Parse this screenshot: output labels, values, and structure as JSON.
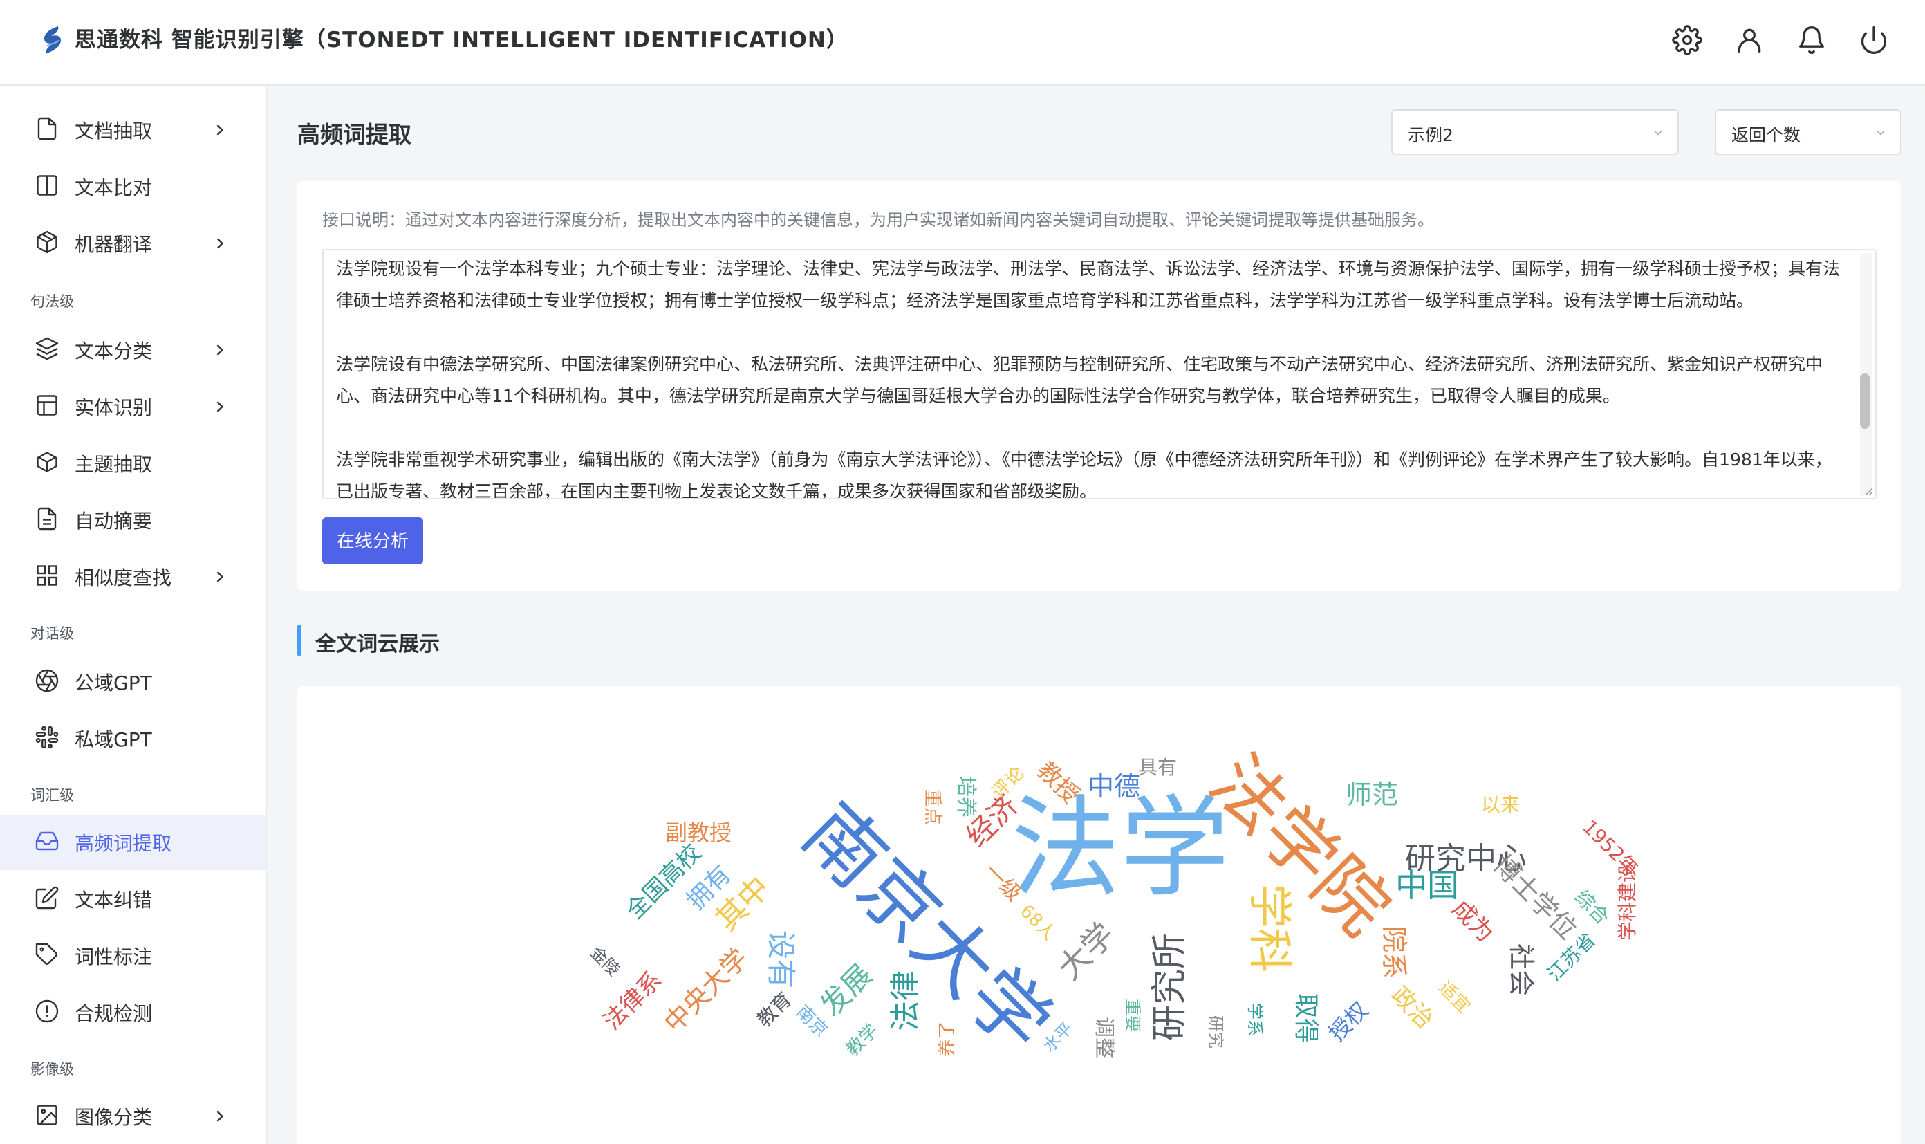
{
  "header": {
    "app_title": "思通数科 智能识别引擎（STONEDT INTELLIGENT IDENTIFICATION）",
    "icons": [
      "settings-icon",
      "user-icon",
      "bell-icon",
      "power-icon"
    ]
  },
  "sidebar": {
    "items": [
      {
        "label": "文档抽取",
        "icon": "document-icon",
        "has_submenu": true
      },
      {
        "label": "文本比对",
        "icon": "columns-icon",
        "has_submenu": false
      },
      {
        "label": "机器翻译",
        "icon": "cube-icon",
        "has_submenu": true
      },
      {
        "label": "文本分类",
        "icon": "layers-icon",
        "has_submenu": true
      },
      {
        "label": "实体识别",
        "icon": "table-icon",
        "has_submenu": true
      },
      {
        "label": "主题抽取",
        "icon": "box-icon",
        "has_submenu": false
      },
      {
        "label": "自动摘要",
        "icon": "file-text-icon",
        "has_submenu": false
      },
      {
        "label": "相似度查找",
        "icon": "grid-icon",
        "has_submenu": true
      },
      {
        "label": "公域GPT",
        "icon": "aperture-icon",
        "has_submenu": false
      },
      {
        "label": "私域GPT",
        "icon": "slack-icon",
        "has_submenu": false
      },
      {
        "label": "高频词提取",
        "icon": "inbox-icon",
        "has_submenu": false,
        "active": true
      },
      {
        "label": "文本纠错",
        "icon": "edit-icon",
        "has_submenu": false
      },
      {
        "label": "词性标注",
        "icon": "tag-icon",
        "has_submenu": false
      },
      {
        "label": "合规检测",
        "icon": "alert-circle-icon",
        "has_submenu": false
      },
      {
        "label": "图像分类",
        "icon": "image-icon",
        "has_submenu": true
      }
    ],
    "groups": [
      "句法级",
      "对话级",
      "词汇级",
      "影像级"
    ]
  },
  "main": {
    "page_title": "高频词提取",
    "example_select": "示例2",
    "count_select": "返回个数",
    "description": "接口说明：通过对文本内容进行深度分析，提取出文本内容中的关键信息，为用户实现诸如新闻内容关键词自动提取、评论关键词提取等提供基础服务。",
    "text_paragraphs": [
      "法学院现设有一个法学本科专业；九个硕士专业：法学理论、法律史、宪法学与政法学、刑法学、民商法学、诉讼法学、经济法学、环境与资源保护法学、国际学，拥有一级学科硕士授予权；具有法律硕士培养资格和法律硕士专业学位授权；拥有博士学位授权一级学科点；经济法学是国家重点培育学科和江苏省重点科，法学学科为江苏省一级学科重点学科。设有法学博士后流动站。",
      "法学院设有中德法学研究所、中国法律案例研究中心、私法研究所、法典评注研中心、犯罪预防与控制研究所、住宅政策与不动产法研究中心、经济法研究所、济刑法研究所、紫金知识产权研究中心、商法研究中心等11个科研机构。其中，德法学研究所是南京大学与德国哥廷根大学合办的国际性法学合作研究与教学体，联合培养研究生，已取得令人瞩目的成果。",
      "法学院非常重视学术研究事业，编辑出版的《南大法学》（前身为《南京大学法评论》）、《中德法学论坛》（原《中德经济法研究所年刊》）和《判例评论》在学术界产生了较大影响。自1981年以来，已出版专著、教材三百余部，在国内主要刊物上发表论文数千篇，成果多次获得国家和省部级奖励。"
    ],
    "analyze_button": "在线分析",
    "section_title": "全文词云展示"
  },
  "wordcloud": {
    "colors": {
      "orange": "#e6884a",
      "blue": "#4a7fd6",
      "lightblue": "#6fb1ea",
      "gray": "#8c8c8c",
      "red": "#d9534f",
      "yellow": "#f2c84b",
      "green": "#5cb8a0",
      "darkgray": "#555a63",
      "teal": "#2f9c9c"
    },
    "words": [
      {
        "text": "法学",
        "color": "lightblue"
      },
      {
        "text": "南京大学",
        "color": "blue"
      },
      {
        "text": "法学院",
        "color": "orange"
      },
      {
        "text": "研究中心",
        "color": "darkgray"
      },
      {
        "text": "研究所",
        "color": "darkgray"
      },
      {
        "text": "学科",
        "color": "yellow"
      },
      {
        "text": "中国",
        "color": "teal"
      },
      {
        "text": "中德",
        "color": "blue"
      },
      {
        "text": "师范",
        "color": "green"
      },
      {
        "text": "教授",
        "color": "orange"
      },
      {
        "text": "经济",
        "color": "red"
      },
      {
        "text": "副教授",
        "color": "orange"
      },
      {
        "text": "全国高校",
        "color": "teal"
      },
      {
        "text": "拥有",
        "color": "lightblue"
      },
      {
        "text": "其中",
        "color": "yellow"
      },
      {
        "text": "中央大学",
        "color": "orange"
      },
      {
        "text": "法律系",
        "color": "red"
      },
      {
        "text": "金陵",
        "color": "darkgray"
      },
      {
        "text": "设有",
        "color": "lightblue"
      },
      {
        "text": "发展",
        "color": "green"
      },
      {
        "text": "法律",
        "color": "teal"
      },
      {
        "text": "大学",
        "color": "gray"
      },
      {
        "text": "院系",
        "color": "orange"
      },
      {
        "text": "成为",
        "color": "red"
      },
      {
        "text": "博士学位",
        "color": "gray"
      },
      {
        "text": "1952年",
        "color": "red"
      },
      {
        "text": "以来",
        "color": "yellow"
      },
      {
        "text": "具有",
        "color": "gray"
      },
      {
        "text": "培养",
        "color": "green"
      },
      {
        "text": "重点",
        "color": "orange"
      },
      {
        "text": "评论",
        "color": "yellow"
      },
      {
        "text": "一级",
        "color": "orange"
      },
      {
        "text": "68人",
        "color": "yellow"
      },
      {
        "text": "教育",
        "color": "darkgray"
      },
      {
        "text": "南京",
        "color": "lightblue"
      },
      {
        "text": "教学",
        "color": "green"
      },
      {
        "text": "养了",
        "color": "orange"
      },
      {
        "text": "水平",
        "color": "lightblue"
      },
      {
        "text": "调整",
        "color": "gray"
      },
      {
        "text": "重要",
        "color": "green"
      },
      {
        "text": "研究",
        "color": "gray"
      },
      {
        "text": "学系",
        "color": "teal"
      },
      {
        "text": "取得",
        "color": "teal"
      },
      {
        "text": "授权",
        "color": "blue"
      },
      {
        "text": "政治",
        "color": "yellow"
      },
      {
        "text": "适宜",
        "color": "yellow"
      },
      {
        "text": "社会",
        "color": "darkgray"
      },
      {
        "text": "江苏省",
        "color": "teal"
      },
      {
        "text": "综合",
        "color": "green"
      },
      {
        "text": "学科建设",
        "color": "red"
      }
    ]
  }
}
